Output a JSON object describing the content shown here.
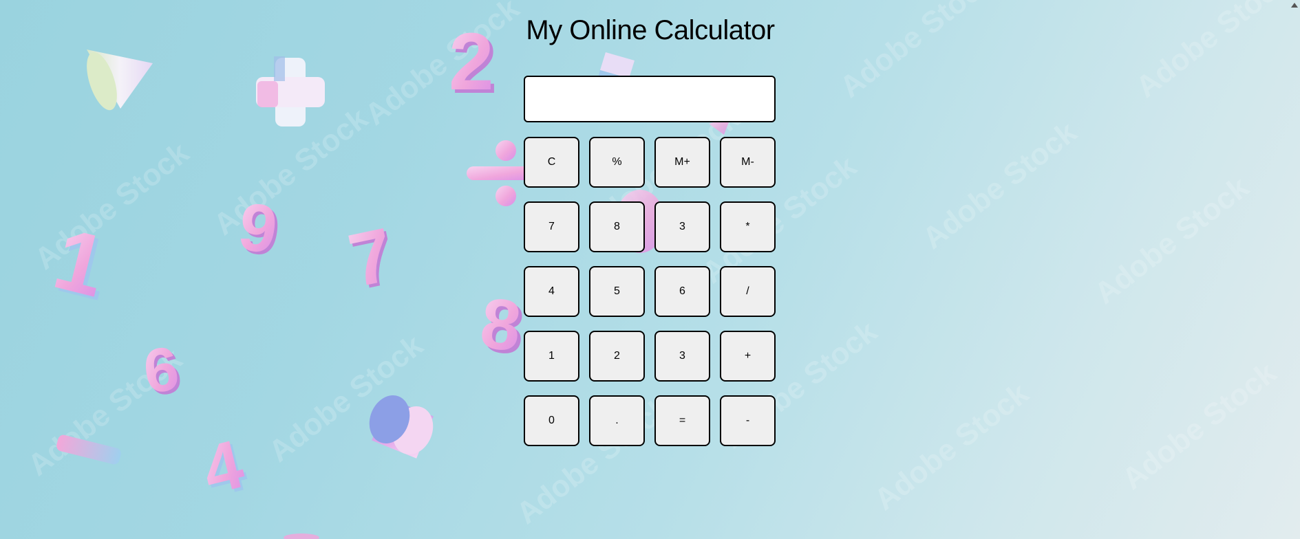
{
  "app": {
    "title": "My Online Calculator"
  },
  "display": {
    "value": "",
    "placeholder": ""
  },
  "keypad": {
    "keys": [
      {
        "label": "C",
        "name": "clear-button"
      },
      {
        "label": "%",
        "name": "percent-button"
      },
      {
        "label": "M+",
        "name": "memory-add-button"
      },
      {
        "label": "M-",
        "name": "memory-subtract-button"
      },
      {
        "label": "7",
        "name": "digit-7-button"
      },
      {
        "label": "8",
        "name": "digit-8-button"
      },
      {
        "label": "3",
        "name": "digit-3-button-row2"
      },
      {
        "label": "*",
        "name": "multiply-button"
      },
      {
        "label": "4",
        "name": "digit-4-button"
      },
      {
        "label": "5",
        "name": "digit-5-button"
      },
      {
        "label": "6",
        "name": "digit-6-button"
      },
      {
        "label": "/",
        "name": "divide-button"
      },
      {
        "label": "1",
        "name": "digit-1-button"
      },
      {
        "label": "2",
        "name": "digit-2-button"
      },
      {
        "label": "3",
        "name": "digit-3-button"
      },
      {
        "label": "+",
        "name": "add-button"
      },
      {
        "label": "0",
        "name": "digit-0-button"
      },
      {
        "label": ".",
        "name": "decimal-button"
      },
      {
        "label": "=",
        "name": "equals-button"
      },
      {
        "label": "-",
        "name": "subtract-button"
      }
    ]
  },
  "background": {
    "watermark_text": "Adobe Stock",
    "floating_digits": [
      "2",
      "9",
      "7",
      "1",
      "6",
      "8",
      "4"
    ],
    "floating_symbols": [
      "plus-shape",
      "divide-shape",
      "minus-shape",
      "cone-shape",
      "cylinder-shape",
      "cube-shape"
    ]
  },
  "colors": {
    "background_start": "#9ad3df",
    "background_end": "#e2ecee",
    "shape_pink": "#f0a6dc",
    "shape_light": "#f6e6f6",
    "key_bg": "#efefef",
    "key_border": "#000000"
  }
}
